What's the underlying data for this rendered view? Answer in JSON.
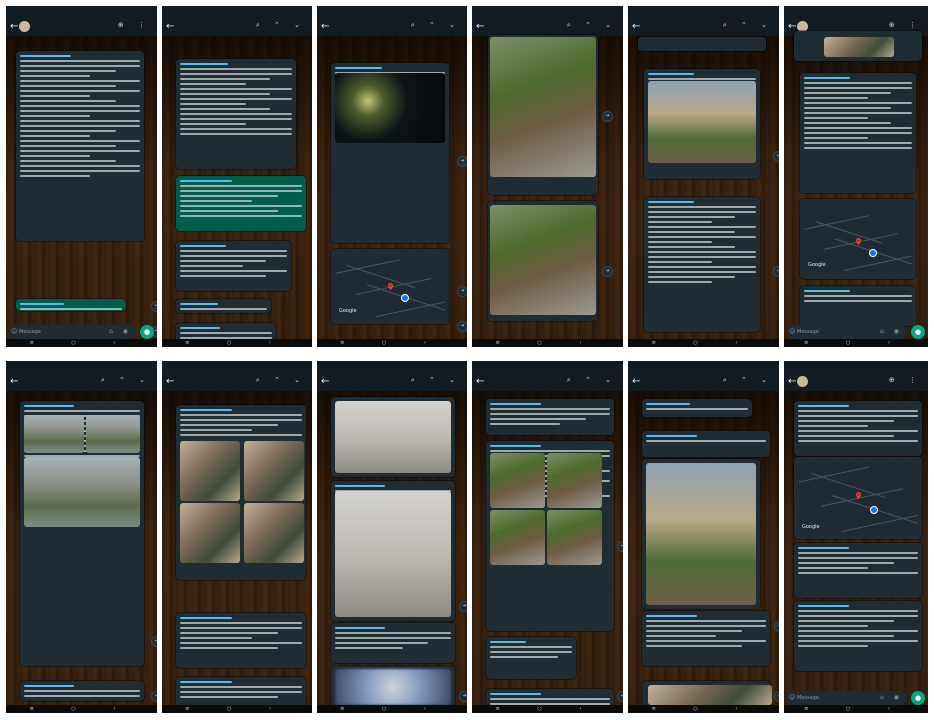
{
  "screen": {
    "background": "#ffffff"
  },
  "colors": {
    "header": "#111b21",
    "bubble_in": "#202c33",
    "bubble_out": "#005c4b",
    "accent": "#00a884",
    "link": "#53bdeb"
  },
  "common": {
    "status_time": "",
    "status_icons": "",
    "message_placeholder": "Message",
    "search_query": "",
    "group_name": "",
    "group_sub": "",
    "nav": "≡ ○ ‹",
    "map_brand": "Google",
    "top_icons": "⌕ ⌃ ⌄"
  },
  "panels": [
    {
      "id": "r1c1",
      "header": "chat",
      "bubbles": [
        [
          10,
          50,
          128,
          190,
          "in",
          24
        ],
        [
          10,
          298,
          110,
          12,
          "out",
          2
        ]
      ],
      "input": true,
      "fabs": [
        [
          145,
          300
        ],
        [
          145,
          325
        ]
      ]
    },
    {
      "id": "r1c2",
      "header": "search",
      "bubbles": [
        [
          14,
          58,
          120,
          110,
          "in",
          14
        ],
        [
          14,
          175,
          130,
          55,
          "out",
          7
        ],
        [
          14,
          240,
          115,
          50,
          "in",
          6
        ],
        [
          14,
          298,
          95,
          14,
          "in",
          2
        ],
        [
          14,
          322,
          100,
          20,
          "in",
          3
        ]
      ],
      "fabs": [
        [
          150,
          300
        ]
      ]
    },
    {
      "id": "r1c3",
      "header": "search",
      "bubbles": [
        [
          14,
          62,
          118,
          180,
          "in",
          10
        ],
        [
          14,
          248,
          118,
          75,
          "in",
          0
        ]
      ],
      "photos": [
        [
          18,
          72,
          110,
          70,
          "night"
        ]
      ],
      "maps": [
        [
          18,
          256,
          110,
          60
        ]
      ],
      "fabs": [
        [
          140,
          155
        ],
        [
          140,
          285
        ],
        [
          140,
          320
        ]
      ]
    },
    {
      "id": "r1c4",
      "header": "search",
      "bubbles": [
        [
          16,
          34,
          110,
          160,
          "in",
          2
        ],
        [
          16,
          200,
          110,
          120,
          "in",
          0
        ]
      ],
      "photos": [
        [
          18,
          36,
          106,
          140,
          "tree"
        ],
        [
          18,
          204,
          106,
          110,
          "tree"
        ]
      ],
      "fabs": [
        [
          130,
          110
        ],
        [
          130,
          265
        ]
      ]
    },
    {
      "id": "r1c5",
      "header": "search",
      "bubbles": [
        [
          10,
          36,
          128,
          14,
          "in",
          0
        ],
        [
          16,
          68,
          116,
          110,
          "in",
          2
        ],
        [
          16,
          196,
          116,
          135,
          "in",
          16
        ]
      ],
      "photos": [
        [
          20,
          80,
          108,
          82,
          "house"
        ]
      ],
      "fabs": [
        [
          145,
          150
        ],
        [
          145,
          265
        ]
      ]
    },
    {
      "id": "r1c6",
      "header": "chat",
      "bubbles": [
        [
          10,
          30,
          128,
          30,
          "in",
          0
        ],
        [
          16,
          72,
          116,
          120,
          "in",
          14
        ],
        [
          16,
          198,
          116,
          80,
          "in",
          0
        ],
        [
          16,
          285,
          116,
          40,
          "in",
          2
        ]
      ],
      "maps": [
        [
          20,
          212,
          108,
          58
        ]
      ],
      "photos": [
        [
          40,
          36,
          70,
          20,
          "group"
        ]
      ],
      "input": true,
      "fabs": [
        [
          144,
          300
        ]
      ]
    },
    {
      "id": "r2c1",
      "header": "search",
      "bubbles": [
        [
          14,
          400,
          124,
          265,
          "in",
          16
        ],
        [
          14,
          680,
          124,
          20,
          "in",
          2
        ]
      ],
      "photos": [
        [
          18,
          414,
          60,
          38,
          "flood"
        ],
        [
          80,
          414,
          54,
          38,
          "flood"
        ],
        [
          18,
          456,
          116,
          70,
          "flood"
        ]
      ],
      "fabs": [
        [
          145,
          635
        ],
        [
          145,
          690
        ]
      ]
    },
    {
      "id": "r2c2",
      "header": "search",
      "bubbles": [
        [
          14,
          404,
          130,
          175,
          "in",
          5
        ],
        [
          14,
          612,
          130,
          55,
          "in",
          6
        ],
        [
          14,
          676,
          130,
          30,
          "in",
          3
        ]
      ],
      "photos": [
        [
          18,
          440,
          60,
          60,
          "group"
        ],
        [
          82,
          440,
          60,
          60,
          "group"
        ],
        [
          18,
          502,
          60,
          60,
          "group"
        ],
        [
          82,
          502,
          60,
          60,
          "group"
        ]
      ],
      "fabs": [
        [
          150,
          530
        ],
        [
          150,
          690
        ]
      ]
    },
    {
      "id": "r2c3",
      "header": "search",
      "bubbles": [
        [
          14,
          396,
          124,
          80,
          "in",
          0
        ],
        [
          14,
          480,
          124,
          140,
          "in",
          2
        ],
        [
          14,
          622,
          124,
          40,
          "in",
          4
        ],
        [
          14,
          665,
          124,
          40,
          "in",
          0
        ]
      ],
      "photos": [
        [
          18,
          400,
          116,
          72,
          "hall"
        ],
        [
          18,
          490,
          116,
          126,
          "hall"
        ],
        [
          18,
          668,
          116,
          36,
          "blur"
        ]
      ],
      "fabs": [
        [
          142,
          600
        ],
        [
          142,
          690
        ]
      ]
    },
    {
      "id": "r2c4",
      "header": "search",
      "bubbles": [
        [
          14,
          398,
          128,
          36,
          "in",
          4
        ],
        [
          14,
          440,
          128,
          190,
          "in",
          10
        ],
        [
          14,
          636,
          90,
          42,
          "in",
          3
        ],
        [
          14,
          688,
          128,
          16,
          "in",
          2
        ]
      ],
      "photos": [
        [
          18,
          452,
          55,
          55,
          "tree"
        ],
        [
          75,
          452,
          55,
          55,
          "tree"
        ],
        [
          18,
          509,
          55,
          55,
          "tree"
        ],
        [
          75,
          509,
          55,
          55,
          "tree"
        ]
      ],
      "fabs": [
        [
          145,
          540
        ],
        [
          145,
          690
        ]
      ]
    },
    {
      "id": "r2c5",
      "header": "search",
      "bubbles": [
        [
          14,
          398,
          110,
          18,
          "in",
          1
        ],
        [
          14,
          430,
          128,
          26,
          "in",
          1
        ],
        [
          14,
          458,
          118,
          150,
          "in",
          0
        ],
        [
          14,
          610,
          128,
          55,
          "in",
          6
        ],
        [
          14,
          680,
          128,
          24,
          "in",
          0
        ]
      ],
      "photos": [
        [
          18,
          462,
          110,
          142,
          "house"
        ],
        [
          20,
          684,
          124,
          20,
          "group"
        ]
      ],
      "fabs": [
        [
          146,
          620
        ],
        [
          146,
          690
        ]
      ]
    },
    {
      "id": "r2c6",
      "header": "chat",
      "bubbles": [
        [
          10,
          400,
          128,
          55,
          "in",
          7
        ],
        [
          10,
          456,
          128,
          82,
          "in",
          0
        ],
        [
          10,
          542,
          128,
          55,
          "in",
          5
        ],
        [
          10,
          600,
          128,
          70,
          "in",
          8
        ]
      ],
      "maps": [
        [
          14,
          462,
          120,
          70
        ]
      ],
      "input": true,
      "fabs": [
        [
          144,
          690
        ]
      ]
    }
  ]
}
